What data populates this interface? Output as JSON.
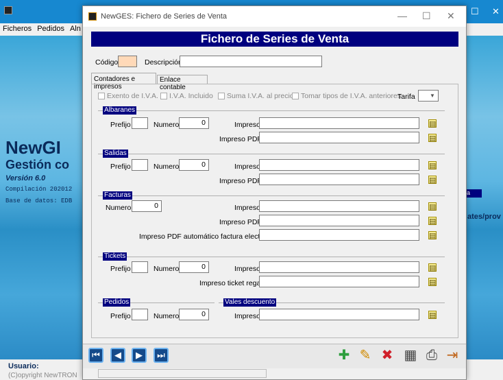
{
  "app": {
    "menu": [
      "Ficheros",
      "Pedidos",
      "Aln"
    ],
    "brand": "NewGI",
    "brand2": "Gestión co",
    "version": "Versión 6.0",
    "compilacion": "Compilación 202012",
    "base": "Base de datos: EDB",
    "right_label": "ates/prov",
    "usuario": "Usuario:",
    "copyright": "(C)opyright NewTRON"
  },
  "dialog": {
    "title": "NewGES: Fichero de Series de Venta",
    "banner": "Fichero de Series de Venta",
    "codigo_label": "Código",
    "descripcion_label": "Descripción",
    "tabs": [
      "Contadores e impresos",
      "Enlace contable"
    ],
    "checks": [
      "Exento de I.V.A.",
      "I.V.A. Incluido",
      "Suma I.V.A. al precio",
      "Tomar tipos de I.V.A. anteriores"
    ],
    "tarifa_label": "Tarifa",
    "prefijo": "Prefijo",
    "numero": "Numero",
    "impreso": "Impreso",
    "impreso_pdf": "Impreso PDF",
    "albaranes": {
      "title": "Albaranes",
      "numero": "0"
    },
    "salidas": {
      "title": "Salidas",
      "numero": "0"
    },
    "facturas": {
      "title": "Facturas",
      "numero": "0",
      "auto_label": "Impreso PDF automático factura electrónica"
    },
    "tickets": {
      "title": "Tickets",
      "numero": "0",
      "regalo_label": "Impreso ticket regalo"
    },
    "pedidos": {
      "title": "Pedidos",
      "numero": "0"
    },
    "vales": {
      "title": "Vales descuento"
    }
  }
}
